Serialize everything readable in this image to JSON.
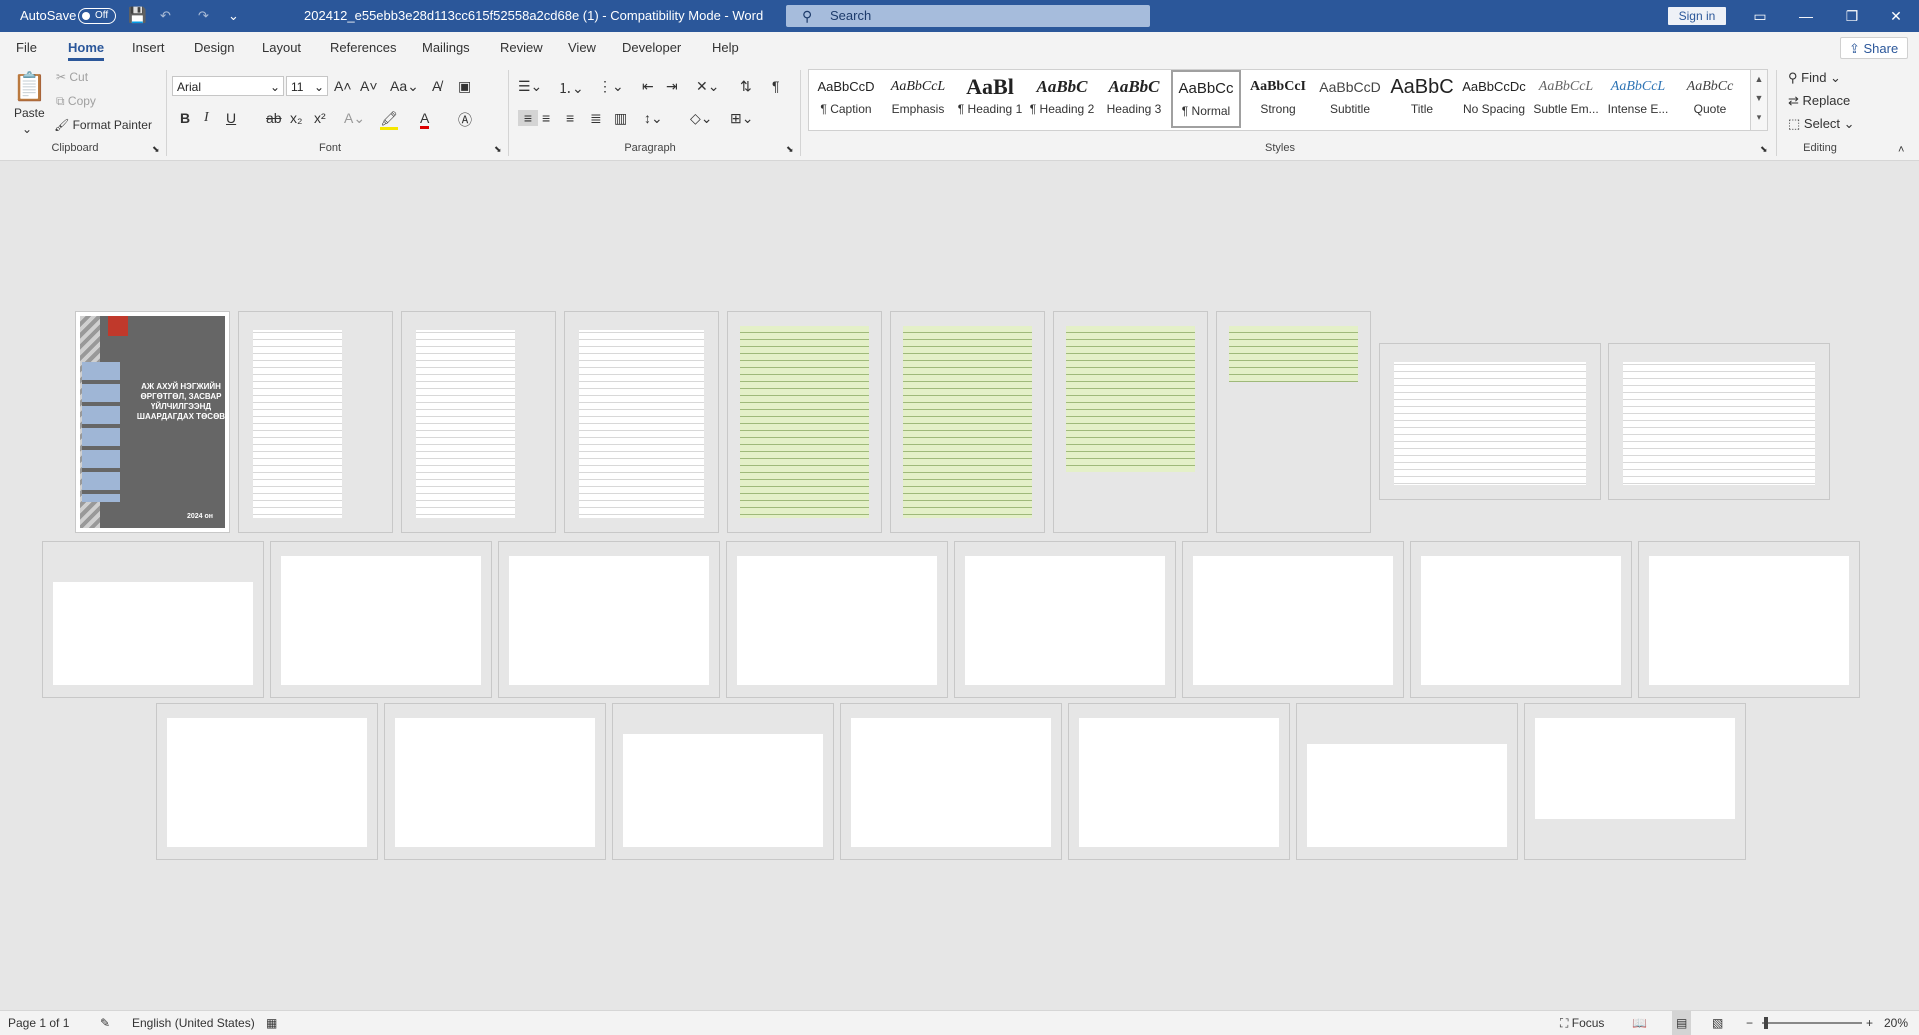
{
  "titlebar": {
    "autosave_label": "AutoSave",
    "autosave_state": "Off",
    "document_title": "202412_e55ebb3e28d113cc615f52558a2cd68e (1)  -  Compatibility Mode  -  Word",
    "search_placeholder": "Search",
    "signin_label": "Sign in"
  },
  "tabs": [
    "File",
    "Home",
    "Insert",
    "Design",
    "Layout",
    "References",
    "Mailings",
    "Review",
    "View",
    "Developer",
    "Help"
  ],
  "share_label": "Share",
  "ribbon": {
    "clipboard": {
      "label": "Clipboard",
      "paste": "Paste",
      "cut": "Cut",
      "copy": "Copy",
      "format_painter": "Format Painter"
    },
    "font": {
      "label": "Font",
      "font_name": "Arial",
      "font_size": "11",
      "bold": "B",
      "italic": "I",
      "underline": "U",
      "strike": "ab",
      "subscript": "x₂",
      "superscript": "x²"
    },
    "paragraph": {
      "label": "Paragraph"
    },
    "styles": {
      "label": "Styles",
      "items": [
        {
          "preview": "AaBbCcD",
          "name": "¶ Caption"
        },
        {
          "preview": "AaBbCcL",
          "name": "Emphasis"
        },
        {
          "preview": "AaBl",
          "name": "¶ Heading 1"
        },
        {
          "preview": "AaBbC",
          "name": "¶ Heading 2"
        },
        {
          "preview": "AaBbC",
          "name": "Heading 3"
        },
        {
          "preview": "AaBbCc",
          "name": "¶ Normal"
        },
        {
          "preview": "AaBbCcI",
          "name": "Strong"
        },
        {
          "preview": "AaBbCcD",
          "name": "Subtitle"
        },
        {
          "preview": "AaBbC",
          "name": "Title"
        },
        {
          "preview": "AaBbCcDc",
          "name": "No Spacing"
        },
        {
          "preview": "AaBbCcL",
          "name": "Subtle Em..."
        },
        {
          "preview": "AaBbCcL",
          "name": "Intense E..."
        },
        {
          "preview": "AaBbCc",
          "name": "Quote"
        }
      ]
    },
    "editing": {
      "label": "Editing",
      "find": "Find",
      "replace": "Replace",
      "select": "Select"
    }
  },
  "document": {
    "cover_title": "АЖ АХУЙ НЭГЖИЙН ӨРГӨТГӨЛ, ЗАСВАР ҮЙЛЧИЛГЭЭНД ШААРДАГДАХ ТӨСӨВ",
    "cover_year": "2024 он"
  },
  "statusbar": {
    "page": "Page 1 of 1",
    "language": "English (United States)",
    "focus": "Focus",
    "zoom": "20%"
  }
}
